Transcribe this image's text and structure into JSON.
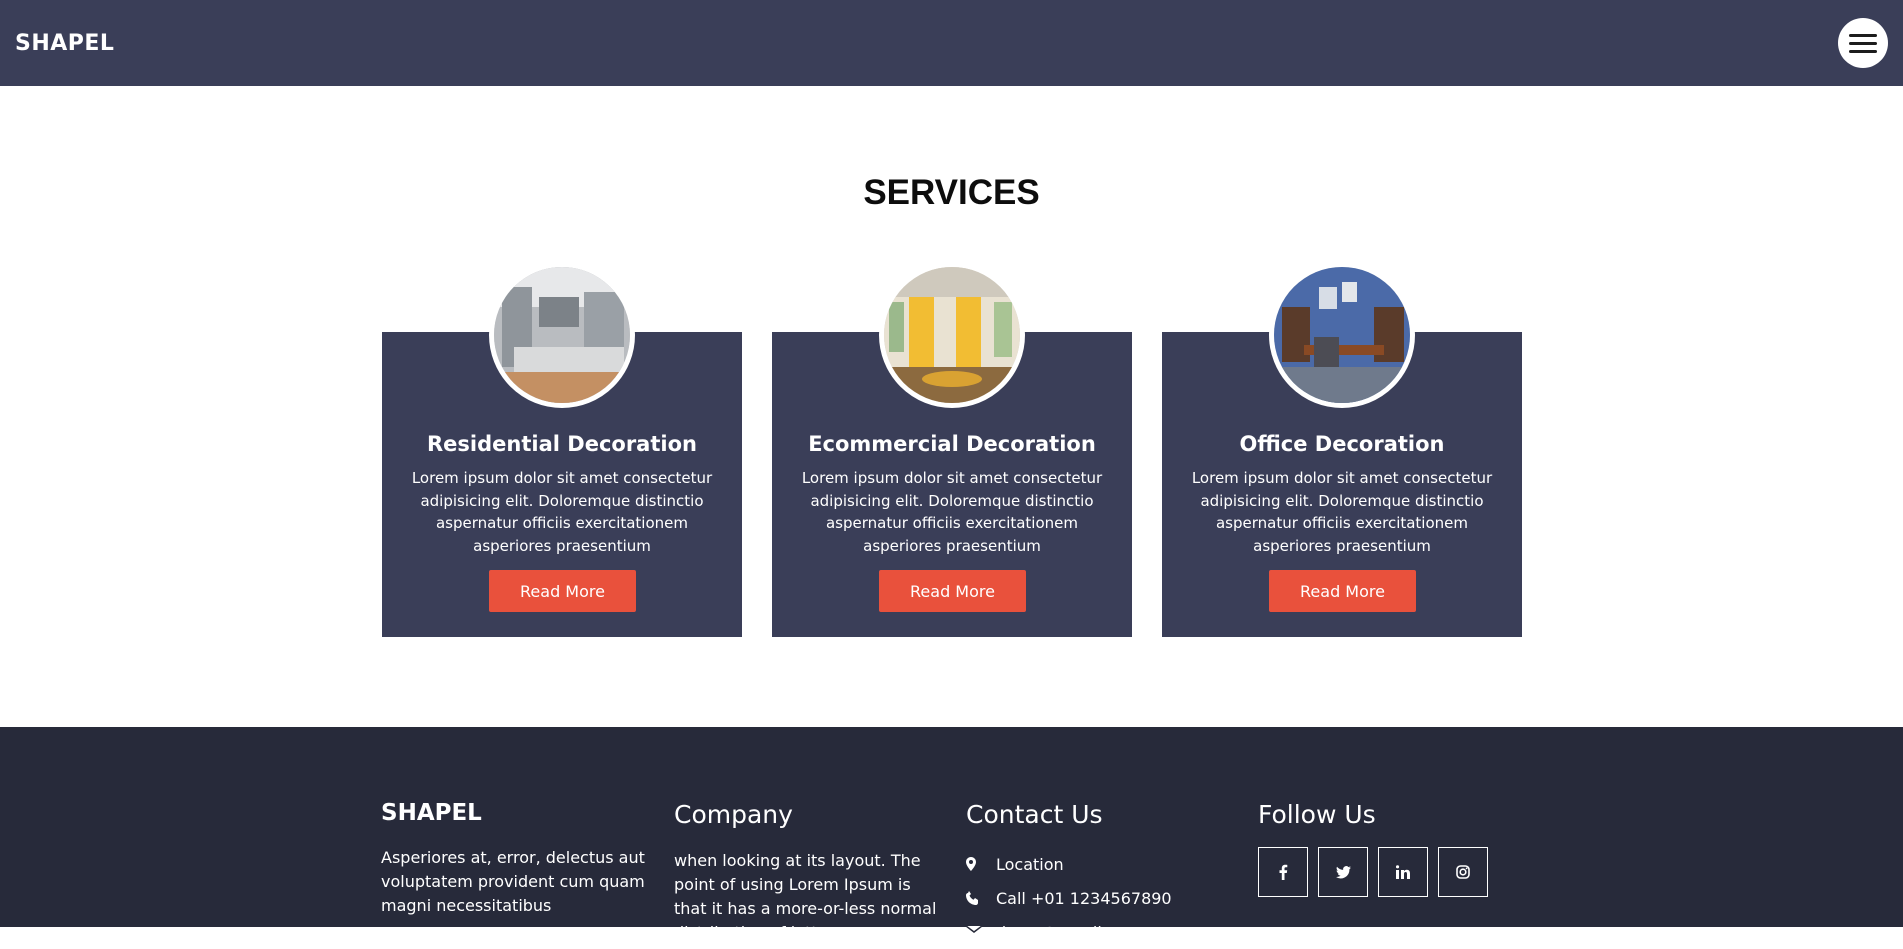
{
  "header": {
    "brand": "SHAPEL",
    "menu_icon": "hamburger-menu-icon"
  },
  "services": {
    "title": "SERVICES",
    "cards": [
      {
        "title": "Residential Decoration",
        "text": "Lorem ipsum dolor sit amet consectetur adipisicing elit. Doloremque distinctio aspernatur officiis exercitationem asperiores praesentium",
        "button": "Read More",
        "image_icon": "kitchen-photo"
      },
      {
        "title": "Ecommercial Decoration",
        "text": "Lorem ipsum dolor sit amet consectetur adipisicing elit. Doloremque distinctio aspernatur officiis exercitationem asperiores praesentium",
        "button": "Read More",
        "image_icon": "restaurant-photo"
      },
      {
        "title": "Office Decoration",
        "text": "Lorem ipsum dolor sit amet consectetur adipisicing elit. Doloremque distinctio aspernatur officiis exercitationem asperiores praesentium",
        "button": "Read More",
        "image_icon": "office-photo"
      }
    ]
  },
  "footer": {
    "brand": "SHAPEL",
    "brand_text": "Asperiores at, error, delectus aut voluptatem provident cum quam magni necessitatibus",
    "company_heading": "Company",
    "company_text": "when looking at its layout. The point of using Lorem Ipsum is that it has a more-or-less normal distribution of letters",
    "contact_heading": "Contact Us",
    "contact": {
      "location": "Location",
      "phone": "Call +01 1234567890",
      "email": "demo@gmail.com"
    },
    "follow_heading": "Follow Us",
    "social_icons": [
      "facebook-icon",
      "twitter-icon",
      "linkedin-icon",
      "instagram-icon"
    ]
  },
  "colors": {
    "header_bg": "#3a3e58",
    "card_bg": "#3a3e58",
    "button_bg": "#e9513c",
    "footer_bg": "#272a3a"
  }
}
